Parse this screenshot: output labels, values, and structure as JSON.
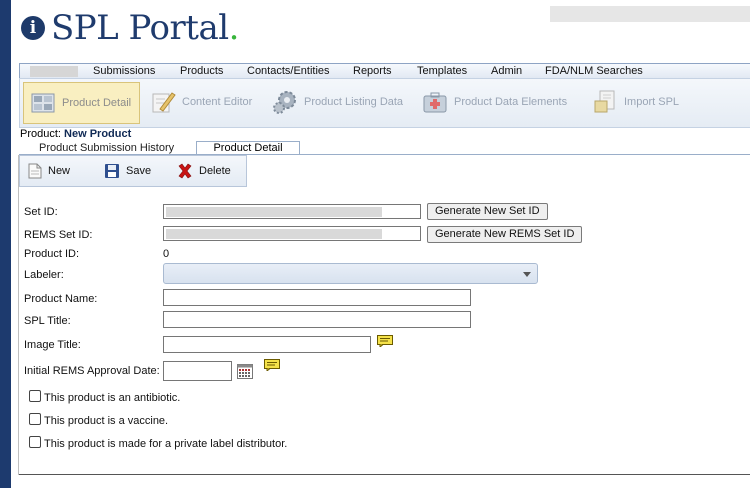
{
  "header": {
    "app_title": "SPL Portal",
    "title_dot": ".",
    "info_icon": "info-icon"
  },
  "menu": {
    "items": [
      "Submissions",
      "Products",
      "Contacts/Entities",
      "Reports",
      "Templates",
      "Admin",
      "FDA/NLM Searches"
    ]
  },
  "toolbar": {
    "items": [
      {
        "label": "Product Detail",
        "icon": "grid-icon",
        "active": true
      },
      {
        "label": "Content Editor",
        "icon": "pencil-icon",
        "active": false
      },
      {
        "label": "Product Listing Data",
        "icon": "gears-icon",
        "active": false
      },
      {
        "label": "Product Data Elements",
        "icon": "medical-kit-icon",
        "active": false
      },
      {
        "label": "Import SPL",
        "icon": "import-icon",
        "active": false
      }
    ]
  },
  "breadcrumb": {
    "prefix": "Product:",
    "value": "New Product"
  },
  "tabs": {
    "history": "Product Submission History",
    "detail": "Product Detail"
  },
  "actions": {
    "new": "New",
    "save": "Save",
    "delete": "Delete"
  },
  "form": {
    "set_id_label": "Set ID:",
    "generate_set_id": "Generate New Set ID",
    "rems_set_id_label": "REMS Set ID:",
    "generate_rems_set_id": "Generate New REMS Set ID",
    "product_id_label": "Product ID:",
    "product_id_value": "0",
    "labeler_label": "Labeler:",
    "product_name_label": "Product Name:",
    "spl_title_label": "SPL Title:",
    "image_title_label": "Image Title:",
    "rems_date_label": "Initial REMS Approval Date:",
    "check_antibiotic": "This product is an antibiotic.",
    "check_vaccine": "This product is a vaccine.",
    "check_private_label": "This product is made for a private label distributor."
  },
  "colors": {
    "brand_navy": "#1f3b6d",
    "brand_green": "#37b53b",
    "active_tool_bg": "#f9efc1"
  }
}
